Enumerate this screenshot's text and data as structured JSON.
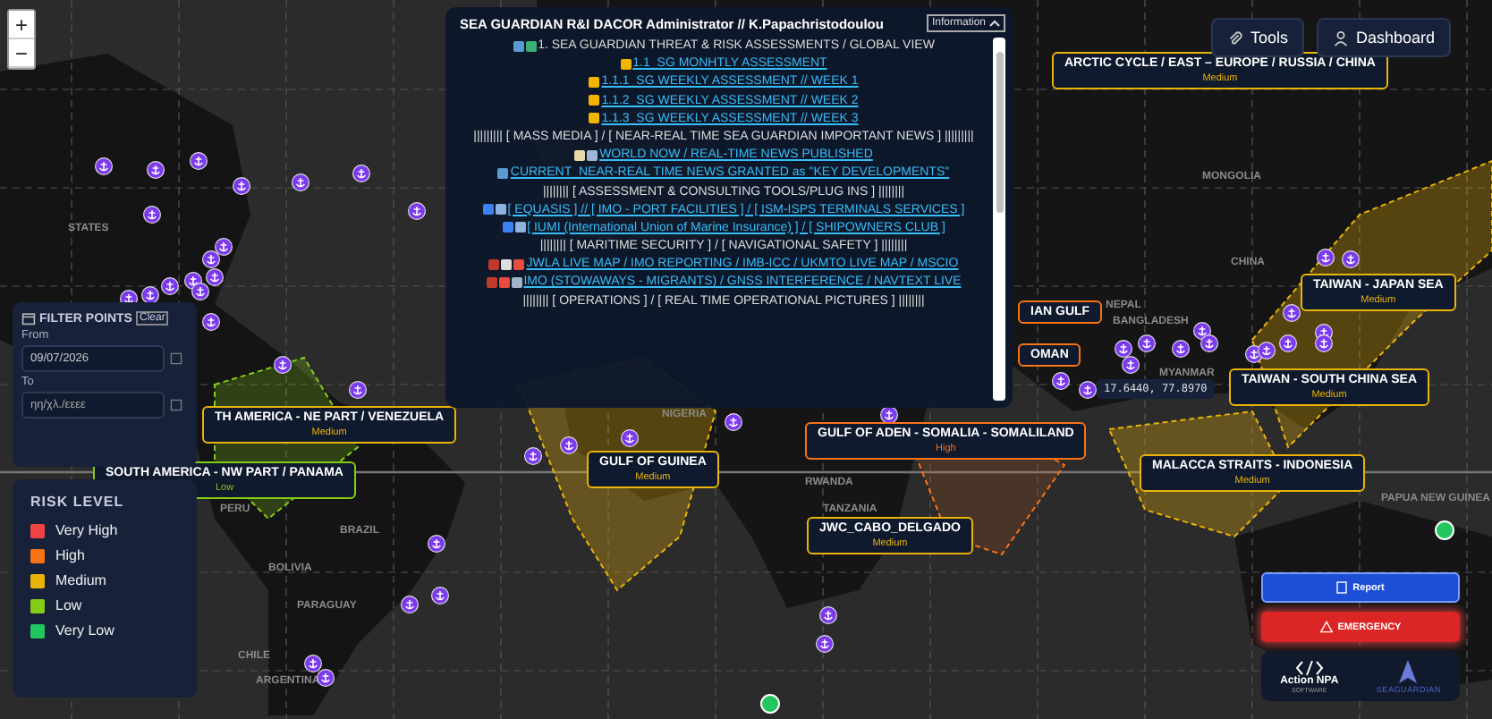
{
  "zoom_controls": [
    "+",
    "−"
  ],
  "info_panel": {
    "title": "SEA GUARDIAN R&I DACOR Administrator // K.Papachristodoulou",
    "dropdown": "Information",
    "lines": [
      {
        "kind": "heading",
        "text": "1. SEA GUARDIAN THREAT & RISK ASSESSMENTS / GLOBAL VIEW"
      },
      {
        "kind": "link",
        "text": "1.1_SG MONHTLY ASSESSMENT"
      },
      {
        "kind": "link",
        "text": "1.1.1_SG WEEKLY ASSESSMENT // WEEK 1"
      },
      {
        "kind": "link",
        "text": "1.1.2_SG WEEKLY ASSESSMENT // WEEK 2"
      },
      {
        "kind": "link",
        "text": "1.1.3_SG WEEKLY ASSESSMENT // WEEK 3"
      },
      {
        "kind": "heading",
        "text": "||||||||| [ MASS MEDIA ] / [ NEAR-REAL TIME SEA GUARDIAN IMPORTANT NEWS ] |||||||||"
      },
      {
        "kind": "link",
        "text": "WORLD NOW / REAL-TIME NEWS PUBLISHED"
      },
      {
        "kind": "link",
        "text": "CURRENT_NEAR-REAL TIME NEWS GRANTED as \"KEY DEVELOPMENTS\""
      },
      {
        "kind": "heading",
        "text": "|||||||| [ ASSESSMENT & CONSULTING TOOLS/PLUG INS ] ||||||||"
      },
      {
        "kind": "link",
        "text": "[ EQUASIS ] // [ IMO - PORT FACILITIES ] / [ ISM-ISPS TERMINALS SERVICES ]"
      },
      {
        "kind": "link",
        "text": "[ IUMI (International Union of Marine Insurance) ] / [ SHIPOWNERS CLUB ]"
      },
      {
        "kind": "heading",
        "text": "|||||||| [ MARITIME SECURITY ] / [ NAVIGATIONAL SAFETY ] ||||||||"
      },
      {
        "kind": "link",
        "text": "JWLA LIVE MAP / IMO REPORTING / IMB-ICC / UKMTO LIVE MAP / MSCIO"
      },
      {
        "kind": "link",
        "text": "IMO (STOWAWAYS - MIGRANTS) / GNSS INTERFERENCE / NAVTEXT LIVE"
      },
      {
        "kind": "heading",
        "text": "|||||||| [ OPERATIONS ] / [ REAL TIME OPERATIONAL PICTURES ] ||||||||"
      }
    ]
  },
  "toolbar": [
    "Tools",
    "Dashboard"
  ],
  "filter_points": {
    "title": "FILTER POINTS",
    "clear": "Clear",
    "from_label": "From",
    "from_value": "09/07/2026",
    "to_label": "To",
    "to_placeholder": "ηη/χλ./εεεε"
  },
  "risk_legend": {
    "title": "RISK LEVEL",
    "items": [
      {
        "label": "Very High",
        "color": "#ef4444"
      },
      {
        "label": "High",
        "color": "#f97316"
      },
      {
        "label": "Medium",
        "color": "#eab308"
      },
      {
        "label": "Low",
        "color": "#84cc16"
      },
      {
        "label": "Very Low",
        "color": "#22c55e"
      }
    ]
  },
  "map_labels": [
    "STATES",
    "PERU",
    "BRAZIL",
    "BOLIVIA",
    "PARAGUAY",
    "CHILE",
    "ARGENTINA",
    "NIGERIA",
    "RWANDA",
    "TANZANIA",
    "MONGOLIA",
    "CHINA",
    "NEPAL",
    "BANGLADESH",
    "MYANMAR",
    "PAPUA NEW GUINEA"
  ],
  "regions": [
    {
      "name": "ARCTIC CYCLE / EAST – EUROPE / RUSSIA / CHINA",
      "risk": "Medium",
      "color": "#eab308"
    },
    {
      "name": "TAIWAN - JAPAN SEA",
      "risk": "Medium",
      "color": "#eab308"
    },
    {
      "name": "IAN GULF",
      "color": "#f97316"
    },
    {
      "name": "OMAN",
      "color": "#f97316"
    },
    {
      "name": "TAIWAN - SOUTH CHINA SEA",
      "risk": "Medium",
      "color": "#eab308"
    },
    {
      "name": "TH AMERICA - NE PART / VENEZUELA",
      "risk": "Medium",
      "color": "#eab308"
    },
    {
      "name": "GULF OF ADEN - SOMALIA - SOMALILAND",
      "risk": "High",
      "color": "#f97316"
    },
    {
      "name": "GULF OF GUINEA",
      "risk": "Medium",
      "color": "#eab308"
    },
    {
      "name": "MALACCA STRAITS - INDONESIA",
      "risk": "Medium",
      "color": "#eab308"
    },
    {
      "name": "SOUTH AMERICA - NW PART / PANAMA",
      "risk": "Low",
      "color": "#84cc16"
    },
    {
      "name": "JWC_CABO_DELGADO",
      "risk": "Medium",
      "color": "#eab308"
    }
  ],
  "coordinates": "17.6440, 77.8970",
  "points": [
    {
      "color": "#22c55e"
    },
    {
      "color": "#22c55e"
    }
  ],
  "actions": {
    "report": "Report",
    "emergency": "EMERGENCY"
  },
  "logo": {
    "name": "Action NPA",
    "sub": "SOFTWARE",
    "brand": "SEAGUARDIAN"
  }
}
